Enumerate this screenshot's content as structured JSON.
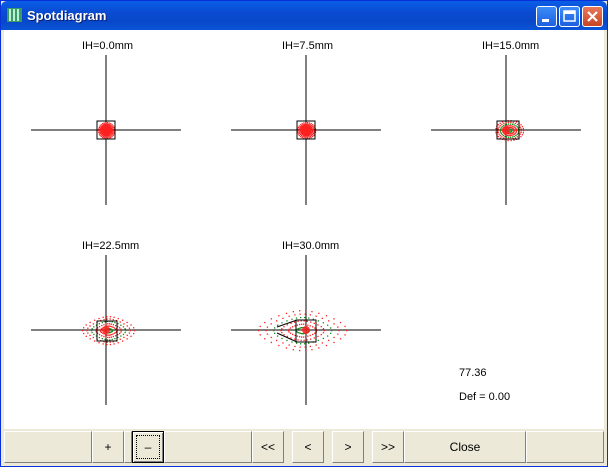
{
  "window": {
    "title": "Spotdiagram"
  },
  "plots": [
    {
      "label": "IH=0.0mm"
    },
    {
      "label": "IH=7.5mm"
    },
    {
      "label": "IH=15.0mm"
    },
    {
      "label": "IH=22.5mm"
    },
    {
      "label": "IH=30.0mm"
    }
  ],
  "info": {
    "value": "77.36",
    "def": "Def = 0.00"
  },
  "toolbar": {
    "zoom_in_label": "+",
    "zoom_out_label": "–",
    "first_label": "<<",
    "prev_label": "<",
    "next_label": ">",
    "last_label": ">>",
    "close_label": "Close"
  },
  "colors": {
    "titlebar": "#0a54d8",
    "spot_red": "#ff2020",
    "spot_green": "#1a8a1a"
  }
}
